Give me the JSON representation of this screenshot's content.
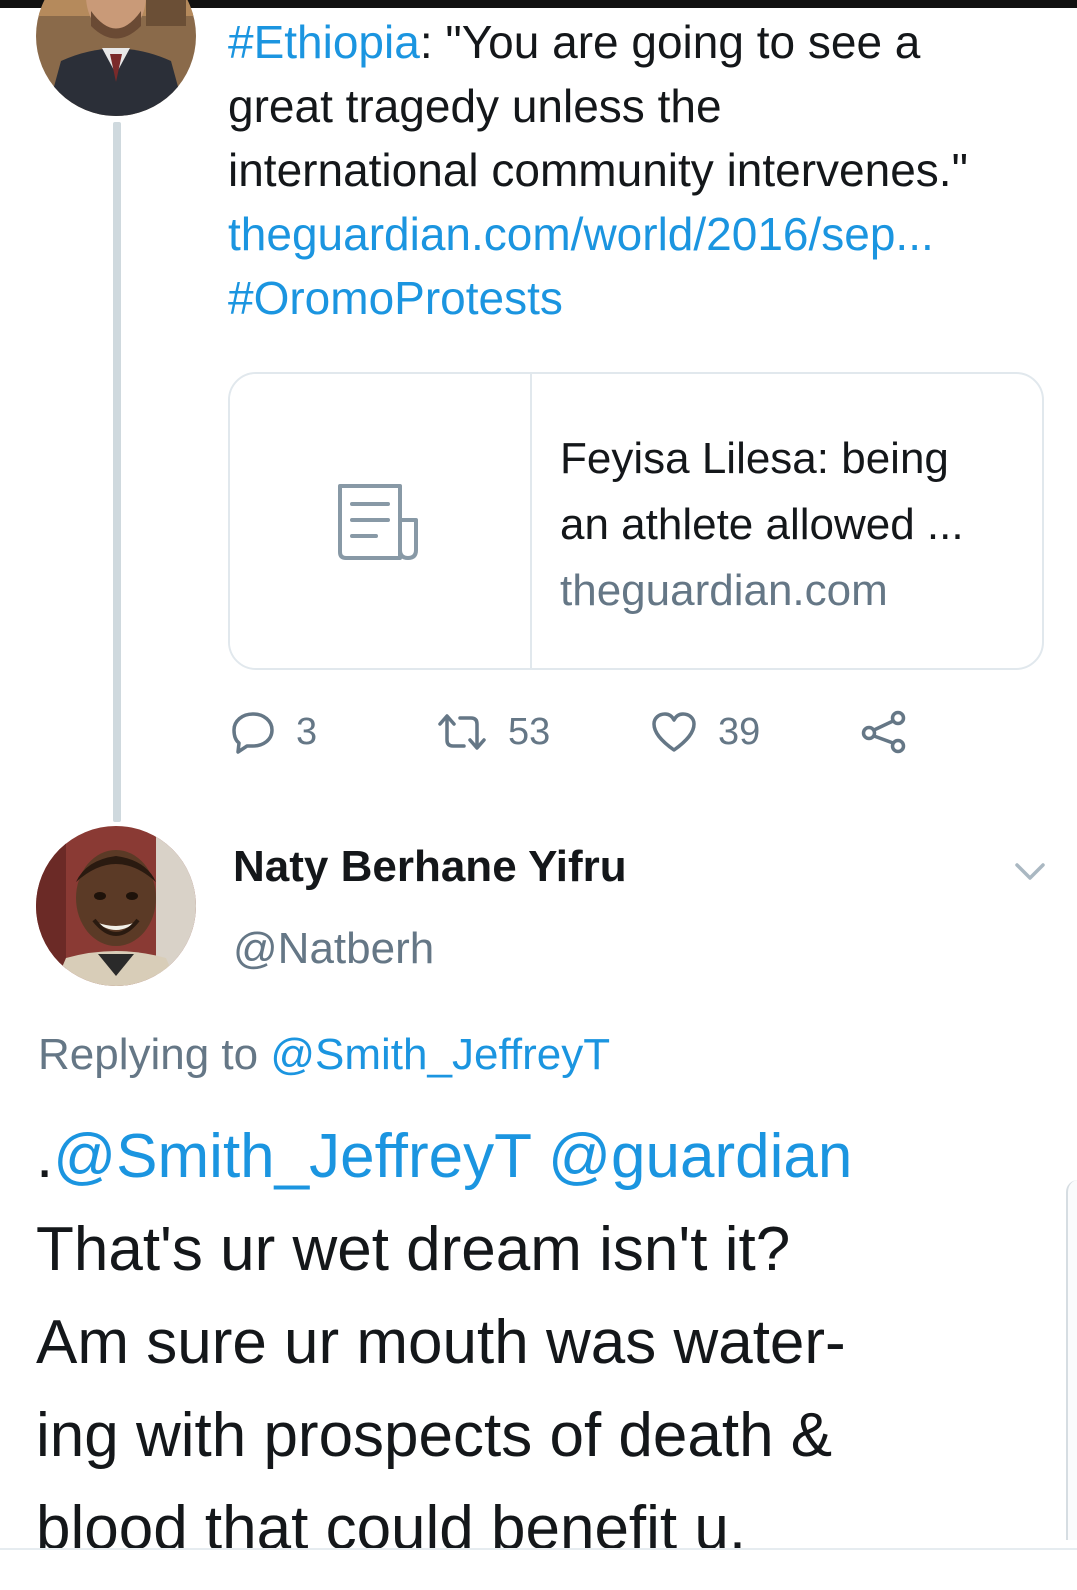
{
  "parent_tweet": {
    "text": {
      "hashtag_1": "#Ethiopia",
      "quote_part_1": ": \"You are going to see a",
      "quote_line_2": "great tragedy unless the",
      "quote_line_3": "international community intervenes.\"",
      "url": "theguardian.com/world/2016/sep...",
      "hashtag_2": "#OromoProtests"
    },
    "card": {
      "icon": "article-icon",
      "title_line_1": "Feyisa Lilesa: being",
      "title_line_2": "an athlete allowed ...",
      "domain": "theguardian.com"
    },
    "actions": {
      "replies": "3",
      "retweets": "53",
      "likes": "39"
    }
  },
  "reply_tweet": {
    "display_name": "Naty Berhane Yifru",
    "handle": "@Natberh",
    "replying_to_label": "Replying to ",
    "replying_to_handle": "@Smith_JeffreyT",
    "text": {
      "prefix": ".",
      "mention_1": "@Smith_JeffreyT",
      "mention_2": "@guardian",
      "line_2": "That's ur wet dream isn't it?",
      "line_3": "Am sure ur mouth was water-",
      "line_4": "ing with prospects of death &",
      "line_5": "blood that could benefit u."
    }
  },
  "colors": {
    "link": "#1b95e0",
    "secondary_text": "#657786",
    "primary_text": "#14171a",
    "border": "#e1e8ed",
    "thread_line": "#cfd9de"
  }
}
